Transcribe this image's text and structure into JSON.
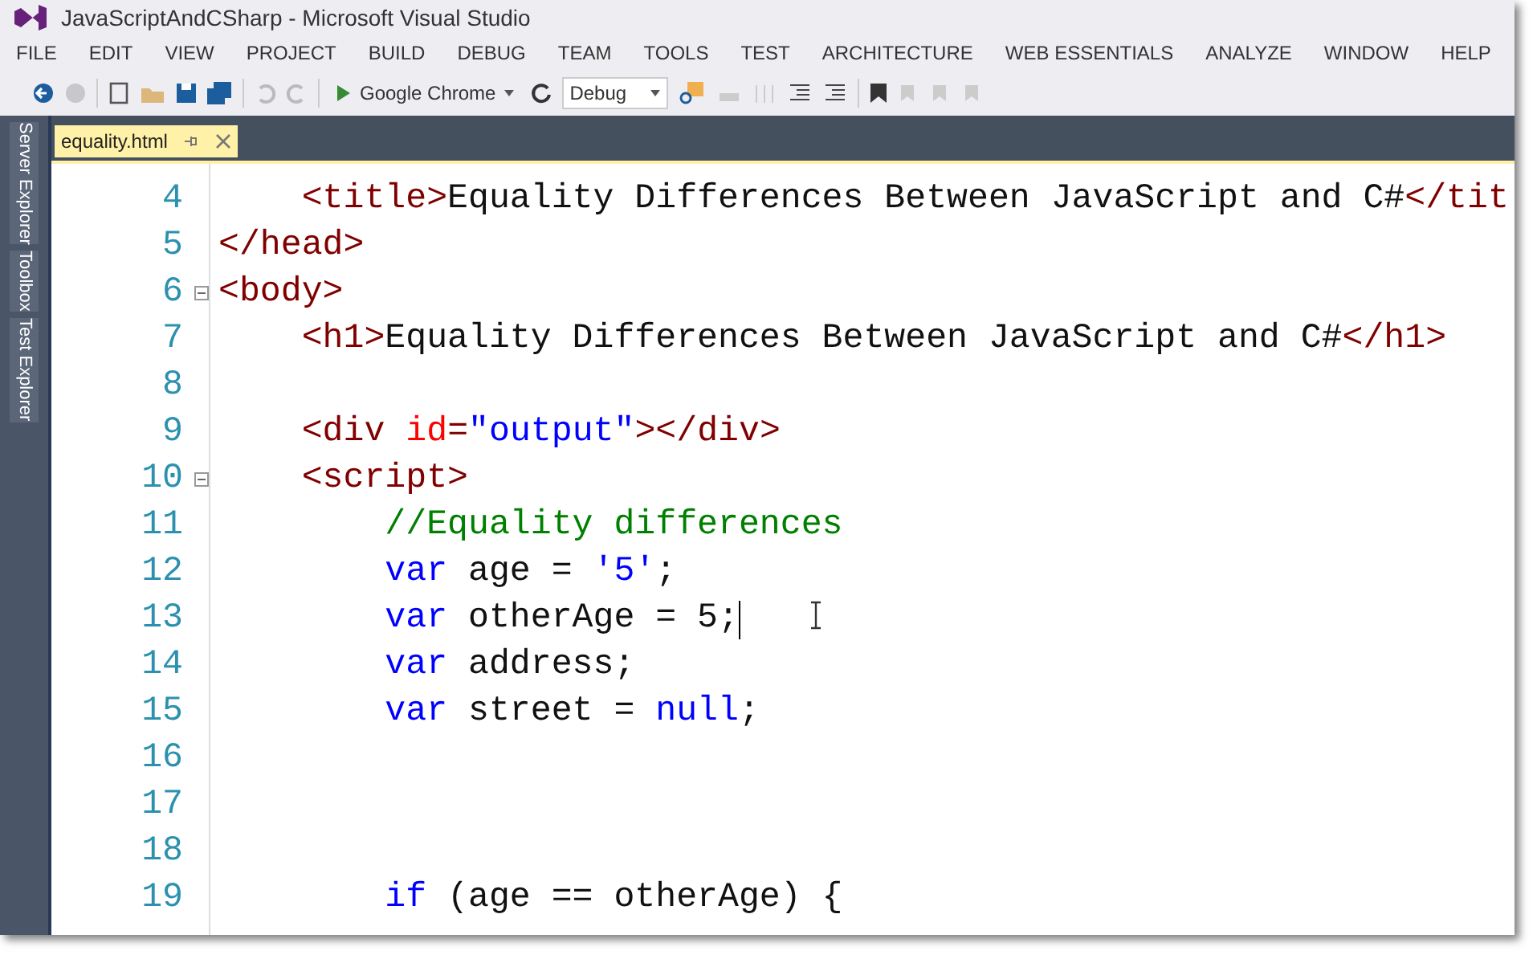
{
  "window": {
    "title": "JavaScriptAndCSharp - Microsoft Visual Studio"
  },
  "menu": [
    "FILE",
    "EDIT",
    "VIEW",
    "PROJECT",
    "BUILD",
    "DEBUG",
    "TEAM",
    "TOOLS",
    "TEST",
    "ARCHITECTURE",
    "WEB ESSENTIALS",
    "ANALYZE",
    "WINDOW",
    "HELP"
  ],
  "toolbar": {
    "run_target": "Google Chrome",
    "configuration": "Debug"
  },
  "side_tabs": [
    "Server Explorer",
    "Toolbox",
    "Test Explorer"
  ],
  "tabs": [
    {
      "label": "equality.html",
      "selected": true
    }
  ],
  "editor": {
    "lines": [
      {
        "number": "4",
        "foldable": false,
        "caret": false,
        "tokens": [
          {
            "kind": "tag",
            "text": "    <title>"
          },
          {
            "kind": "text",
            "text": "Equality Differences Between JavaScript and C#"
          },
          {
            "kind": "tag",
            "text": "</tit"
          }
        ]
      },
      {
        "number": "5",
        "foldable": false,
        "caret": false,
        "tokens": [
          {
            "kind": "tag",
            "text": "</head>"
          }
        ]
      },
      {
        "number": "6",
        "foldable": true,
        "caret": false,
        "tokens": [
          {
            "kind": "tag",
            "text": "<body>"
          }
        ]
      },
      {
        "number": "7",
        "foldable": false,
        "caret": false,
        "tokens": [
          {
            "kind": "tag",
            "text": "    <h1>"
          },
          {
            "kind": "text",
            "text": "Equality Differences Between JavaScript and C#"
          },
          {
            "kind": "tag",
            "text": "</h1>"
          }
        ]
      },
      {
        "number": "8",
        "foldable": false,
        "caret": false
      },
      {
        "number": "9",
        "foldable": false,
        "caret": false,
        "tokens": [
          {
            "kind": "tag",
            "text": "    <div "
          },
          {
            "kind": "attr",
            "text": "id"
          },
          {
            "kind": "tag",
            "text": "="
          },
          {
            "kind": "string",
            "text": "\"output\""
          },
          {
            "kind": "tag",
            "text": "></div>"
          }
        ]
      },
      {
        "number": "10",
        "foldable": true,
        "caret": false,
        "tokens": [
          {
            "kind": "tag",
            "text": "    <script>"
          }
        ]
      },
      {
        "number": "11",
        "foldable": false,
        "caret": false,
        "tokens": [
          {
            "kind": "comment",
            "text": "        //Equality differences"
          }
        ]
      },
      {
        "number": "12",
        "foldable": false,
        "caret": false,
        "tokens": [
          {
            "kind": "keyword",
            "text": "        var"
          },
          {
            "kind": "text",
            "text": " age = "
          },
          {
            "kind": "string",
            "text": "'5'"
          },
          {
            "kind": "text",
            "text": ";"
          }
        ]
      },
      {
        "number": "13",
        "foldable": false,
        "caret": true,
        "tokens": [
          {
            "kind": "keyword",
            "text": "        var"
          },
          {
            "kind": "text",
            "text": " otherAge = 5;"
          }
        ]
      },
      {
        "number": "14",
        "foldable": false,
        "caret": false,
        "tokens": [
          {
            "kind": "keyword",
            "text": "        var"
          },
          {
            "kind": "text",
            "text": " address;"
          }
        ]
      },
      {
        "number": "15",
        "foldable": false,
        "caret": false,
        "tokens": [
          {
            "kind": "keyword",
            "text": "        var"
          },
          {
            "kind": "text",
            "text": " street = "
          },
          {
            "kind": "keyword",
            "text": "null"
          },
          {
            "kind": "text",
            "text": ";"
          }
        ]
      },
      {
        "number": "16",
        "foldable": false,
        "caret": false
      },
      {
        "number": "17",
        "foldable": false,
        "caret": false
      },
      {
        "number": "18",
        "foldable": false,
        "caret": false
      },
      {
        "number": "19",
        "foldable": false,
        "caret": false,
        "tokens": [
          {
            "kind": "keyword",
            "text": "        if"
          },
          {
            "kind": "text",
            "text": " (age == otherAge) {"
          }
        ]
      }
    ]
  }
}
